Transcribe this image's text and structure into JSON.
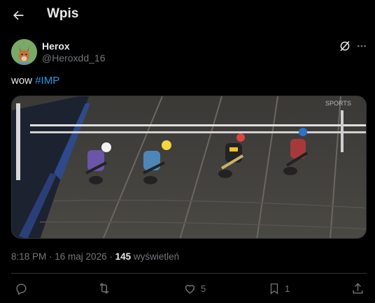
{
  "header": {
    "title": "Wpis",
    "back_icon": "arrow-left-icon"
  },
  "author": {
    "name": "Herox",
    "handle": "@Heroxdd_16",
    "avatar_icon": "avatar-fox-icon"
  },
  "post": {
    "text_prefix": "wow ",
    "hashtag": "#IMP",
    "media": {
      "watermark": "SPORTS",
      "description_icon": "speedway-race-image"
    }
  },
  "meta": {
    "time": "8:18 PM",
    "sep1": " · ",
    "date": "16 maj 2026",
    "sep2": " · ",
    "views_count": "145",
    "views_label": " wyświetleń"
  },
  "actions": {
    "reply": {
      "icon": "reply-icon",
      "count": ""
    },
    "repost": {
      "icon": "repost-icon",
      "count": ""
    },
    "like": {
      "icon": "heart-icon",
      "count": "5"
    },
    "bookmark": {
      "icon": "bookmark-icon",
      "count": "1"
    },
    "share": {
      "icon": "share-icon",
      "count": ""
    }
  },
  "colors": {
    "background": "#000000",
    "text": "#e7e9ea",
    "muted": "#71767b",
    "link": "#1d9bf0",
    "divider": "#2f3336"
  }
}
